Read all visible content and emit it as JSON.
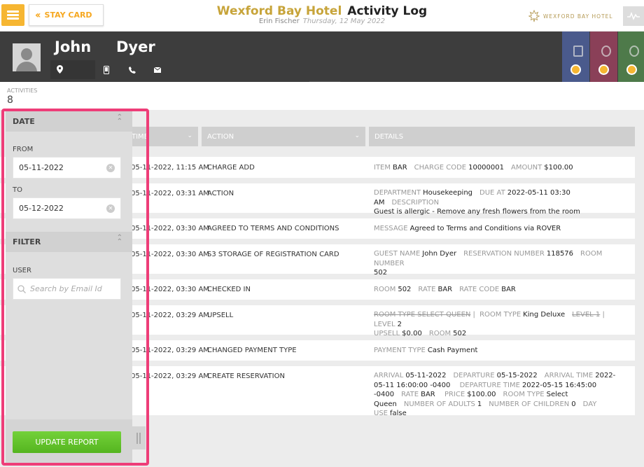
{
  "header": {
    "back_label": "STAY CARD",
    "hotel_name": "Wexford Bay Hotel",
    "page_title": "Activity Log",
    "user_name": "Erin Fischer",
    "date": "Thursday, 12 May 2022",
    "brand_text": "WEXFORD BAY HOTEL"
  },
  "guest": {
    "first_name": "John",
    "last_name": "Dyer"
  },
  "activities": {
    "label": "ACTIVITIES",
    "count": "8"
  },
  "columns": [
    "TIME",
    "ACTION",
    "DETAILS"
  ],
  "rows": [
    {
      "time": "05-11-2022, 11:15 AM",
      "action": "CHARGE ADD"
    },
    {
      "time": "05-11-2022, 03:31 AM",
      "action": "ACTION"
    },
    {
      "time": "05-11-2022, 03:30 AM",
      "action": "AGREED TO TERMS AND CONDITIONS"
    },
    {
      "time": "05-11-2022, 03:30 AM",
      "action": "S3 STORAGE OF REGISTRATION CARD"
    },
    {
      "time": "05-11-2022, 03:30 AM",
      "action": "CHECKED IN"
    },
    {
      "time": "05-11-2022, 03:29 AM",
      "action": "UPSELL"
    },
    {
      "time": "05-11-2022, 03:29 AM",
      "action": "CHANGED PAYMENT TYPE"
    },
    {
      "time": "05-11-2022, 03:29 AM",
      "action": "CREATE RESERVATION"
    }
  ],
  "details": {
    "r0": {
      "k1": "ITEM",
      "v1": "BAR",
      "k2": "CHARGE CODE",
      "v2": "10000001",
      "k3": "AMOUNT",
      "v3": "$100.00"
    },
    "r1": {
      "k1": "DEPARTMENT",
      "v1": "Housekeeping",
      "k2": "DUE AT",
      "v2": "2022-05-11 03:30 AM",
      "k3": "DESCRIPTION",
      "v3": "Guest is allergic - Remove any fresh flowers from the room"
    },
    "r2": {
      "k1": "MESSAGE",
      "v1": "Agreed to Terms and Conditions via ROVER"
    },
    "r3": {
      "k1": "GUEST NAME",
      "v1": "John Dyer",
      "k2": "RESERVATION NUMBER",
      "v2": "118576",
      "k3": "ROOM NUMBER",
      "v3": "502"
    },
    "r4": {
      "k1": "ROOM",
      "v1": "502",
      "k2": "RATE",
      "v2": "BAR",
      "k3": "RATE CODE",
      "v3": "BAR"
    },
    "r5": {
      "s1": "ROOM TYPE SELECT QUEEN",
      "k1": "ROOM TYPE",
      "v1": "King Deluxe",
      "s2": "LEVEL 1",
      "k2": "LEVEL",
      "v2": "2",
      "k3": "UPSELL",
      "v3": "$0.00",
      "k4": "ROOM",
      "v4": "502"
    },
    "r6": {
      "k1": "PAYMENT TYPE",
      "v1": "Cash Payment"
    },
    "r7": {
      "k1": "ARRIVAL",
      "v1": "05-11-2022",
      "k2": "DEPARTURE",
      "v2": "05-15-2022",
      "k3": "ARRIVAL TIME",
      "v3": "2022-05-11 16:00:00 -0400",
      "k4": "DEPARTURE TIME",
      "v4": "2022-05-15 16:45:00 -0400",
      "k5": "RATE",
      "v5": "BAR",
      "k6": "PRICE",
      "v6": "$100.00",
      "k7": "ROOM TYPE",
      "v7": "Select Queen",
      "k8": "NUMBER OF ADULTS",
      "v8": "1",
      "k9": "NUMBER OF CHILDREN",
      "v9": "0",
      "k10": "DAY USE",
      "v10": "false"
    }
  },
  "sidebar": {
    "date_title": "DATE",
    "from_label": "FROM",
    "from_value": "05-11-2022",
    "to_label": "TO",
    "to_value": "05-12-2022",
    "filter_title": "FILTER",
    "user_label": "USER",
    "search_placeholder": "Search by Email Id",
    "update_label": "UPDATE REPORT"
  },
  "colors": {
    "accent": "#f6b632",
    "highlight": "#ee3d78",
    "tile1": "#4a5a8c",
    "tile2": "#8a4058",
    "tile3": "#4e7a4a",
    "update_green": "#5bbf24"
  }
}
